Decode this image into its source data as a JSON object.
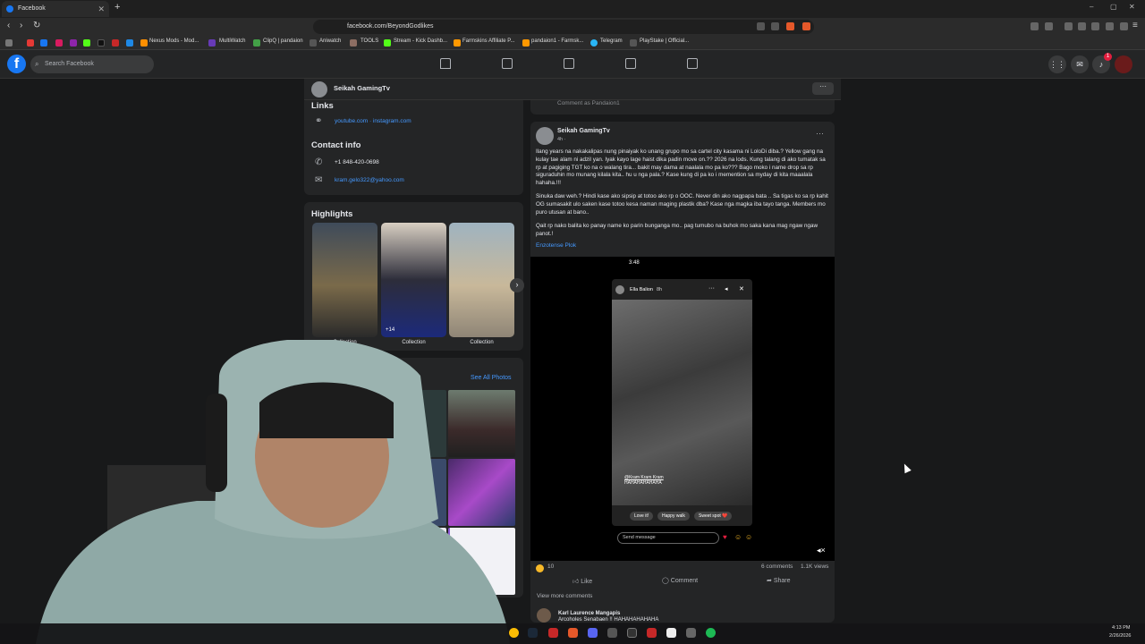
{
  "browser": {
    "tab_title": "Facebook",
    "url": "facebook.com/BeyondGodlikes",
    "new_tab": "+",
    "close": "✕",
    "win_min": "–",
    "win_max": "▢",
    "win_close": "✕",
    "ext_badge": "1"
  },
  "bookmarks": [
    "Nexus Mods - Mod...",
    "MultiWatch",
    "ClipQ | pandaion",
    "Aniwatch",
    "TOOLS",
    "Stream - Kick Dashb...",
    "Farmskins Affiliate P...",
    "pandaion1 - Farmsk...",
    "Telegram",
    "PlayStake | Official..."
  ],
  "fbnav": {
    "logo": "f",
    "search_placeholder": "Search Facebook",
    "notif_count": "1"
  },
  "page": {
    "name": "Seikah GamingTv",
    "more": "···"
  },
  "intro": {
    "links_heading": "Links",
    "links_value": "youtube.com · instagram.com",
    "contact_heading": "Contact info",
    "phone": "+1 848-420-0698",
    "email": "kram.gelo322@yahoo.com"
  },
  "highlights": {
    "heading": "Highlights",
    "items": [
      {
        "caption": "Collection",
        "overlay": ""
      },
      {
        "caption": "Collection",
        "overlay": "+14"
      },
      {
        "caption": "Collection",
        "overlay": ""
      }
    ]
  },
  "photos": {
    "see_all": "See All Photos"
  },
  "post": {
    "comment_as": "Comment as Pandaion1",
    "author": "Seikah GamingTv",
    "time": "4h · ",
    "paragraph1": "Ilang years na nakakalipas nung pinaiyak ko unang grupo mo sa cartel  city kasama ni LoloDi diba.? Yellow gang na kulay tae alam ni adzil yan. Iyak kayo lage haist dika padin move on.?? 2026 na lods. Kung talang di ako tumatak sa rp at pagiging TGT ko na o walang tira... bakit may dama at naalala mo pa ko??? Bago moko i name drop sa rp siguraduhin mo munang kilala kita.. hu u nga pala.? Kase kung di pa ko i memention sa myday di kita maaalala hahaha.!!!",
    "paragraph2": "Sinuka daw weh.? Hindi kase ako sipsip at totoo ako rp o OOC. Never din ako nagpapa bata .. Sa tigas ko sa rp kahit OG sumasakit ulo saken kase totoo kesa naman maging plastik dba? Kase nga magka iba tayo tanga. Members mo puro  utusan at bano..",
    "paragraph3": "Qait rp nako balita ko panay name ko parin bunganga mo.. pag tumubo na buhok mo saka kana mag ngaw ngaw panot.!",
    "tag": "Enzotense Plok",
    "story": {
      "clock": "3:48",
      "user": "Ella Balion",
      "age": "8h",
      "mention": "@Kram Kram Kram",
      "caption_laugh": "HAHAHAHAHAHA",
      "chips": [
        "Love it!",
        "Happy walk",
        "Sweet spot ❤️"
      ],
      "send_placeholder": "Send message"
    },
    "reactions_count": "10",
    "comments_count": "6 comments",
    "views_count": "1.1K views",
    "like": "Like",
    "comment": "Comment",
    "share": "Share",
    "view_more": "View more comments",
    "commenter": "Karl Laurence Mangapis",
    "comment_text": "Arcoholes Senabaen !! HAHAHAHAHAHA"
  },
  "taskbar": {
    "time": "4:13 PM",
    "date": "2/26/2026"
  }
}
